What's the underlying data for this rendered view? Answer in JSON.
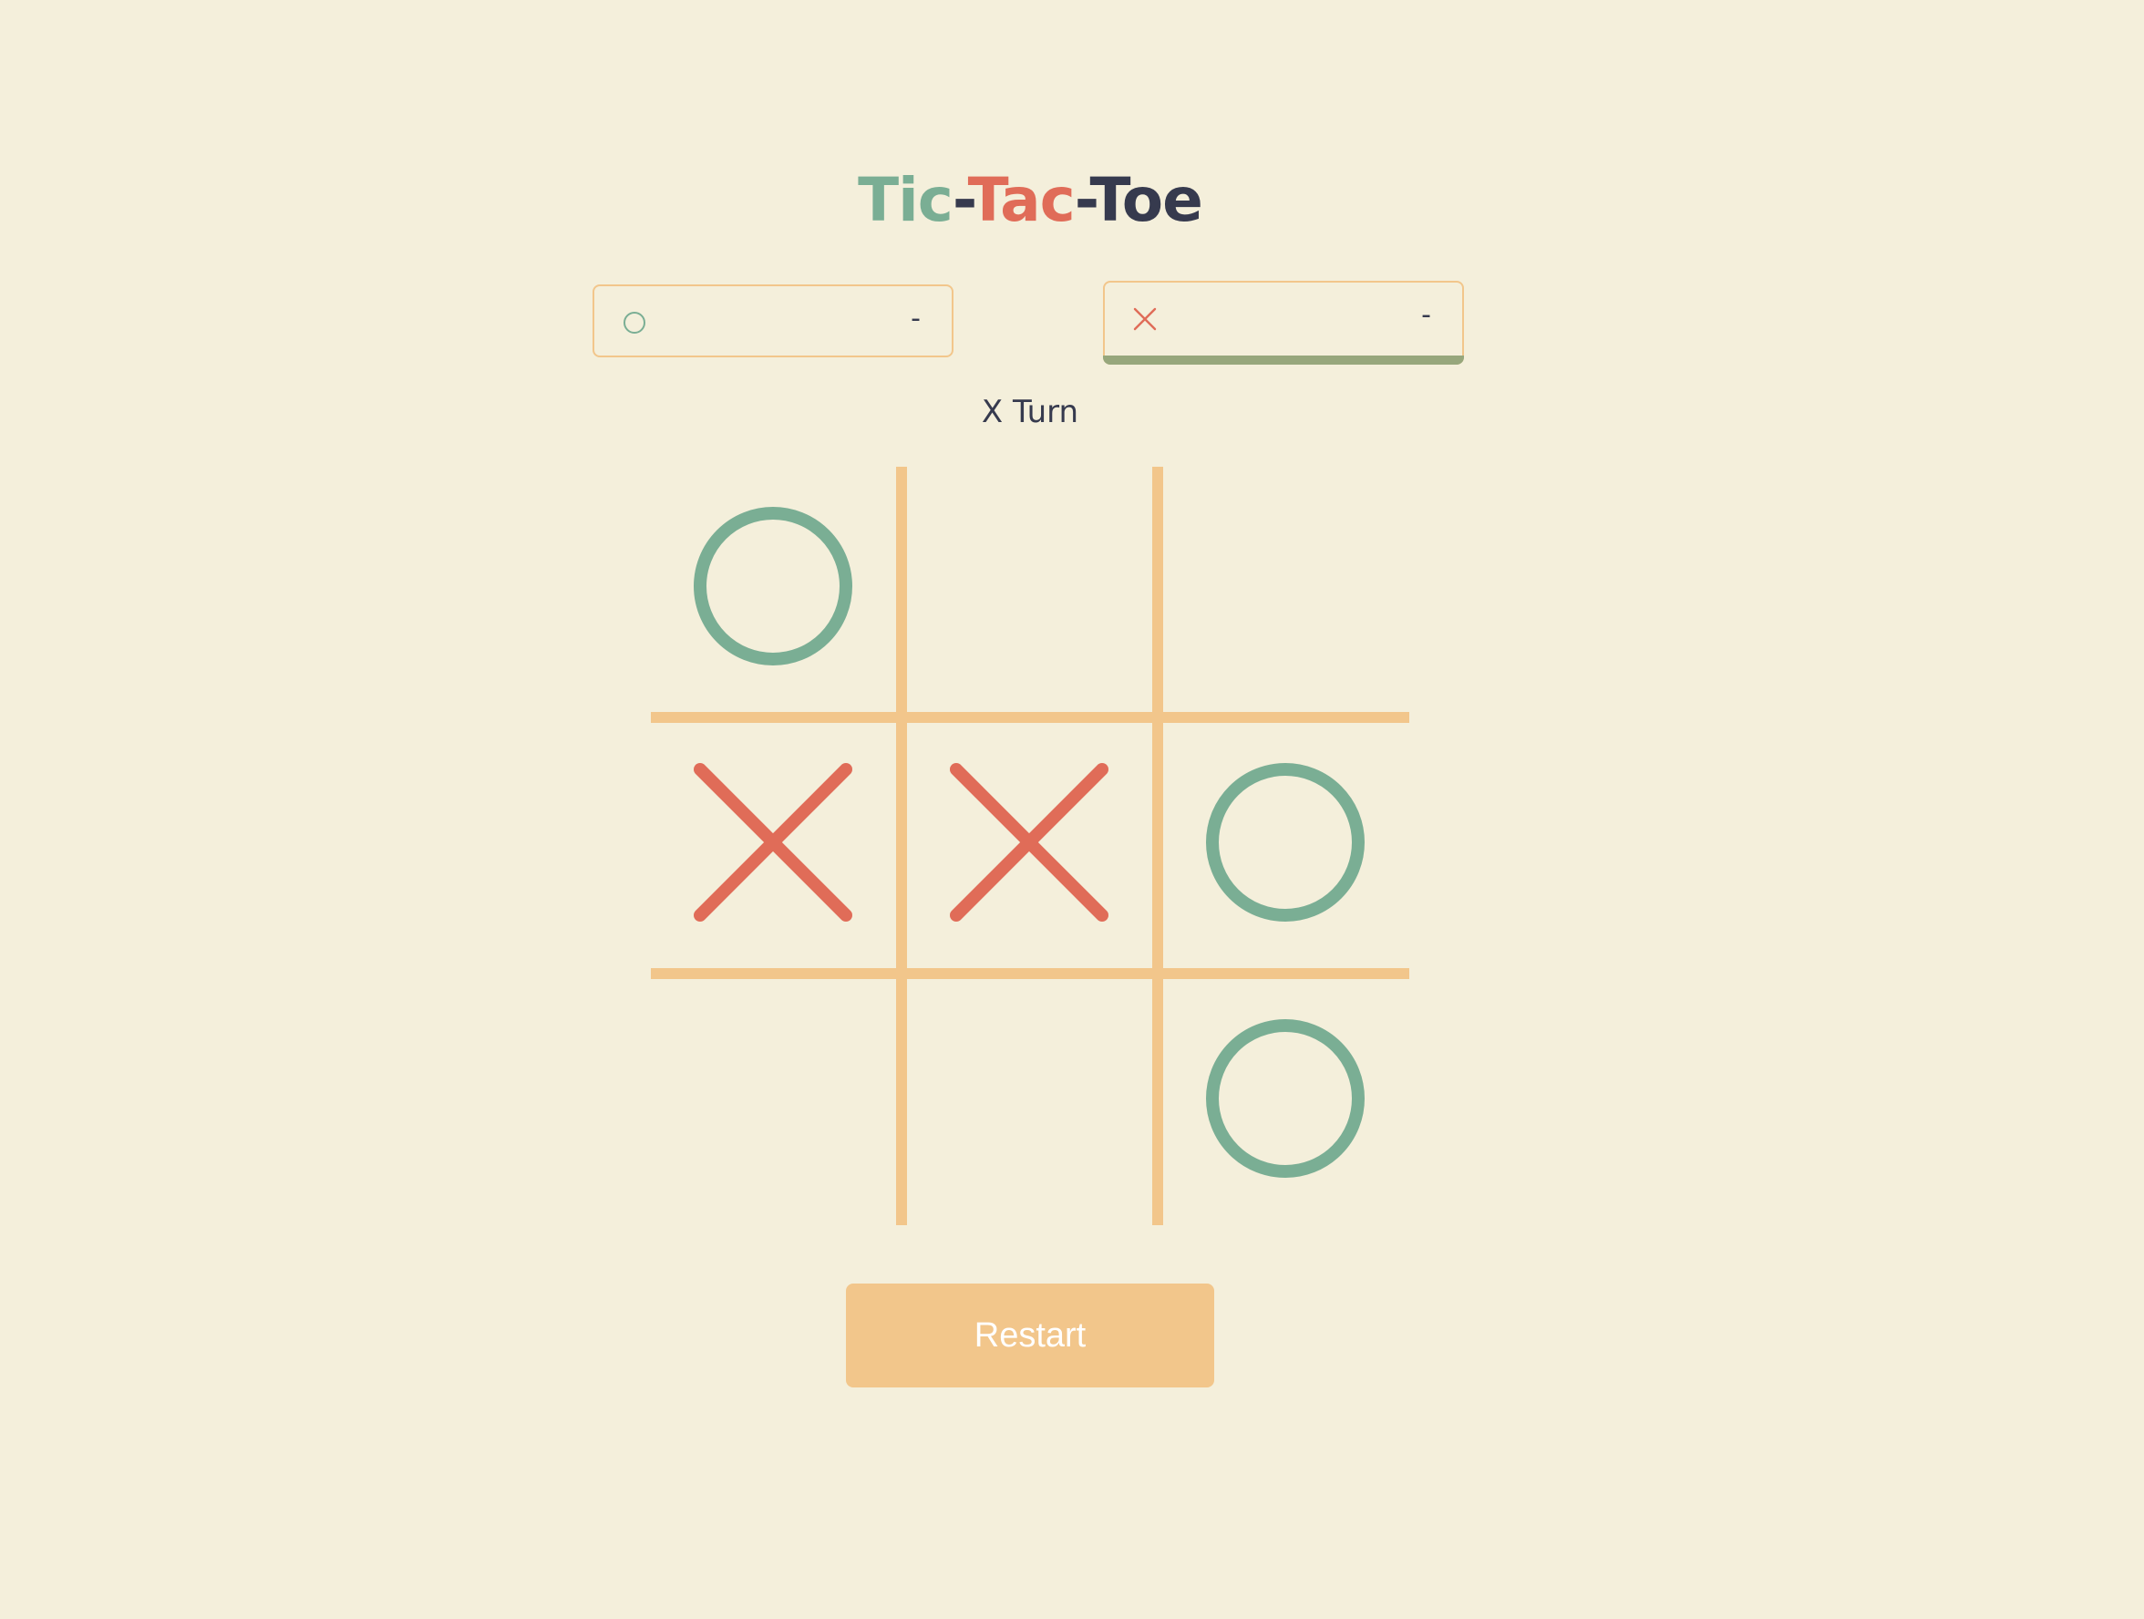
{
  "title": {
    "part1": "Tic",
    "dash1": "-",
    "part2": "Tac",
    "dash2": "-",
    "part3": "Toe"
  },
  "colors": {
    "background": "#f4efdb",
    "o_color": "#7aae94",
    "x_color": "#e06c58",
    "dark": "#363a4e",
    "accent": "#f2c68b",
    "active_indicator": "#97a77c"
  },
  "scoreboard": {
    "o": {
      "icon": "circle-icon",
      "score": "-"
    },
    "x": {
      "icon": "cross-icon",
      "score": "-",
      "active": true
    }
  },
  "status": {
    "turn_text": "X Turn"
  },
  "board": {
    "cells": [
      "O",
      "",
      "",
      "X",
      "X",
      "O",
      "",
      "",
      "O"
    ]
  },
  "controls": {
    "restart_label": "Restart"
  }
}
